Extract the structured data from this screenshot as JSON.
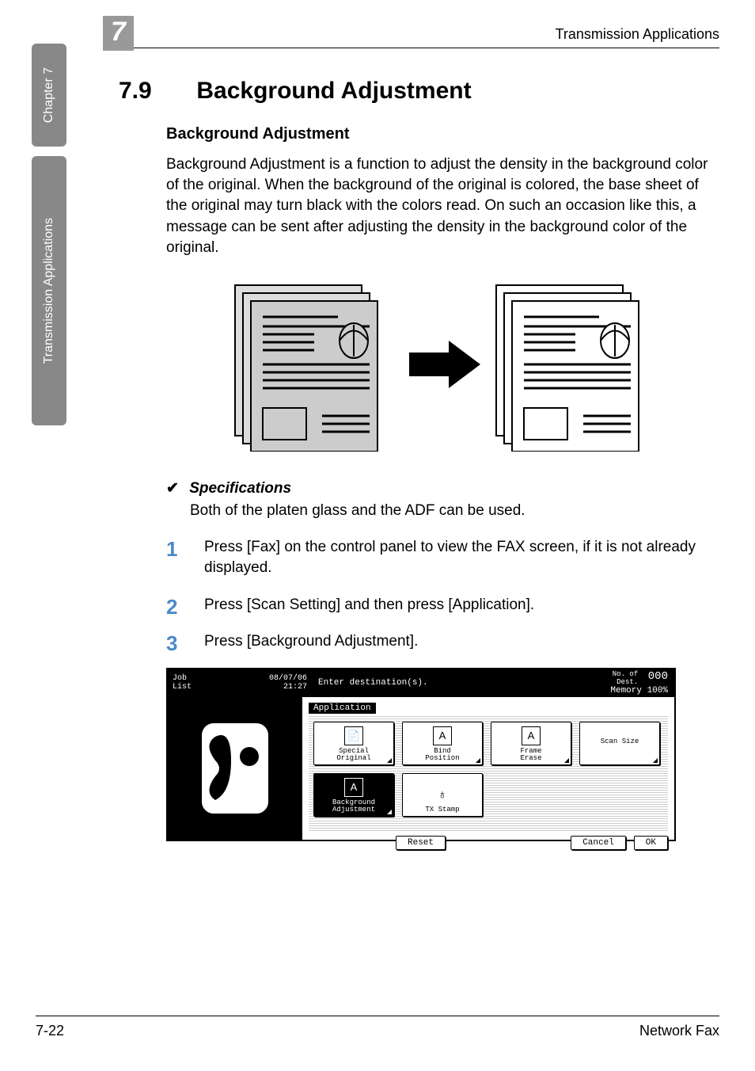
{
  "sidebar": {
    "chapter_label": "Chapter 7",
    "section_label": "Transmission Applications"
  },
  "header": {
    "chapter_number": "7",
    "right_text": "Transmission Applications"
  },
  "section": {
    "number": "7.9",
    "title": "Background Adjustment"
  },
  "subheading": "Background Adjustment",
  "body_para": "Background Adjustment is a function to adjust the density in the background color of the original. When the background of the original is colored, the base sheet of the original may turn black with the colors read. On such an occasion like this, a message can be sent after adjusting the density in the background color of the original.",
  "spec": {
    "check": "✔",
    "label": "Specifications",
    "text": "Both of the platen glass and the ADF can be used."
  },
  "steps": [
    {
      "num": "1",
      "text": "Press [Fax] on the control panel to view the FAX screen, if it is not already displayed."
    },
    {
      "num": "2",
      "text": "Press [Scan Setting] and then press [Application]."
    },
    {
      "num": "3",
      "text": "Press [Background Adjustment]."
    }
  ],
  "panel": {
    "job_list": "Job\nList",
    "datetime": "08/07/06\n21:27",
    "enter_dest": "Enter destination(s).",
    "dest_count_label": "No. of\nDest.",
    "dest_count": "000",
    "memory": "Memory 100%",
    "application_label": "Application",
    "buttons_row1": [
      {
        "id": "special-original",
        "label": "Special\nOriginal",
        "icon": "📄"
      },
      {
        "id": "bind-position",
        "label": "Bind\nPosition",
        "icon": "A"
      },
      {
        "id": "frame-erase",
        "label": "Frame\nErase",
        "icon": "A"
      },
      {
        "id": "scan-size",
        "label": "Scan Size",
        "icon": ""
      }
    ],
    "buttons_row2": [
      {
        "id": "background-adjustment",
        "label": "Background\nAdjustment",
        "icon": "A",
        "selected": true
      },
      {
        "id": "tx-stamp",
        "label": "TX Stamp",
        "icon": "⊕"
      }
    ],
    "footer_buttons": {
      "reset": "Reset",
      "cancel": "Cancel",
      "ok": "OK"
    }
  },
  "footer": {
    "left": "7-22",
    "right": "Network Fax"
  }
}
